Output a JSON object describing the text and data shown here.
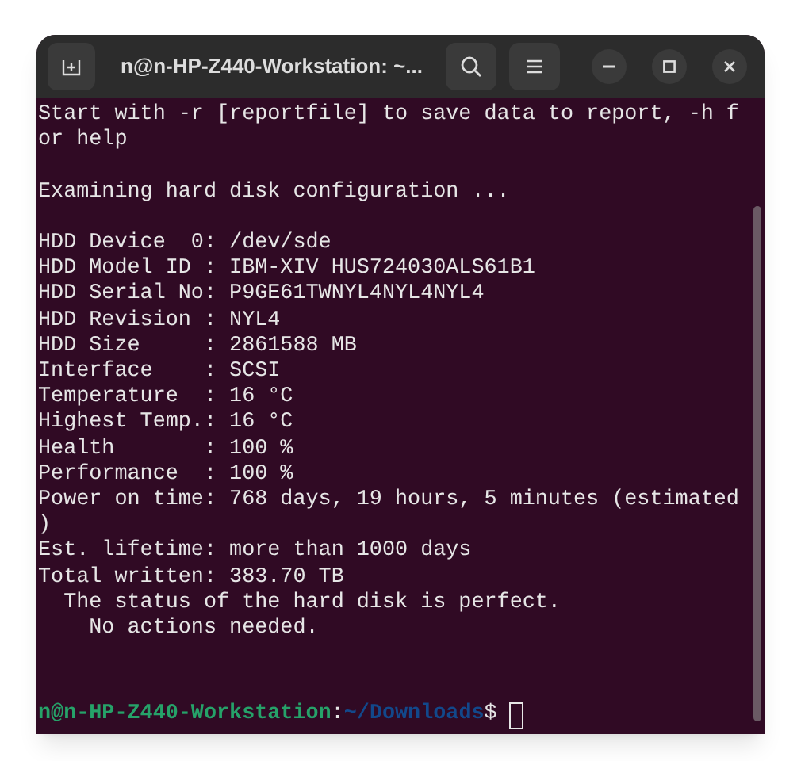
{
  "window": {
    "title": "n@n-HP-Z440-Workstation: ~..."
  },
  "output": [
    [
      "Start with -r [reportfile] to save data to report, -h f",
      "or help"
    ],
    [
      "Examining hard disk configuration ..."
    ],
    [
      "HDD Device  0: /dev/sde",
      "HDD Model ID : IBM-XIV HUS724030ALS61B1",
      "HDD Serial No: P9GE61TWNYL4NYL4NYL4",
      "HDD Revision : NYL4",
      "HDD Size     : 2861588 MB",
      "Interface    : SCSI",
      "Temperature  : 16 °C",
      "Highest Temp.: 16 °C",
      "Health       : 100 %",
      "Performance  : 100 %",
      "Power on time: 768 days, 19 hours, 5 minutes (estimated",
      ")",
      "Est. lifetime: more than 1000 days",
      "Total written: 383.70 TB",
      "  The status of the hard disk is perfect.",
      "    No actions needed."
    ]
  ],
  "prompt": {
    "user_host": "n@n-HP-Z440-Workstation",
    "separator": ":",
    "path": "~/Downloads",
    "symbol": "$"
  }
}
